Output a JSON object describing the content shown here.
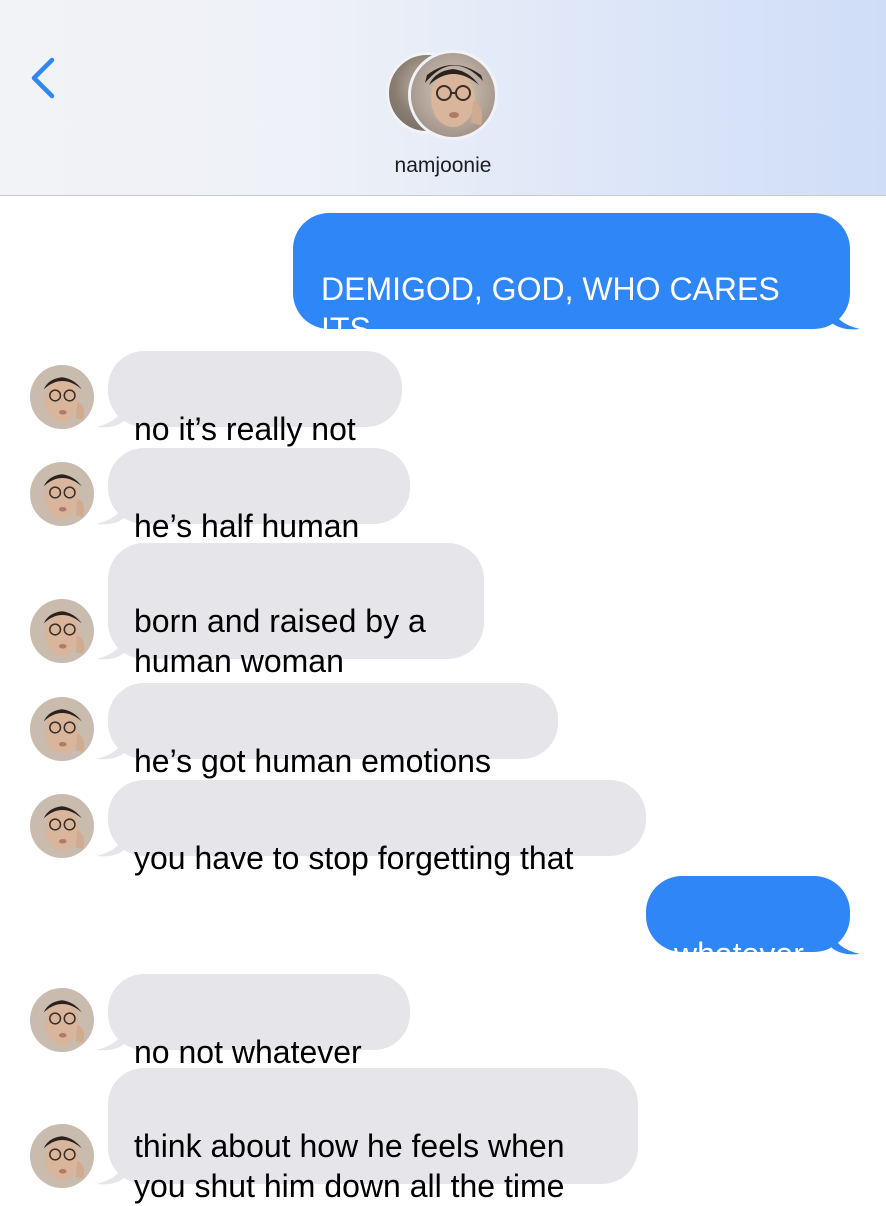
{
  "header": {
    "contact_name": "namjoonie",
    "back_icon": "chevron-left-icon",
    "accent_color": "#2f86f6"
  },
  "messages": [
    {
      "from": "me",
      "text": "DEMIGOD, GOD, WHO CARES ITS\nTHE SAME THING"
    },
    {
      "from": "them",
      "text": "no it’s really not"
    },
    {
      "from": "them",
      "text": "he’s half human"
    },
    {
      "from": "them",
      "text": "born and raised by a\nhuman woman"
    },
    {
      "from": "them",
      "text": "he’s got human emotions"
    },
    {
      "from": "them",
      "text": "you have to stop forgetting that"
    },
    {
      "from": "me",
      "text": "whatever"
    },
    {
      "from": "them",
      "text": "no not whatever"
    },
    {
      "from": "them",
      "text": "think about how he feels when\nyou shut him down all the time"
    }
  ],
  "colors": {
    "incoming_bubble": "#e5e5ea",
    "outgoing_bubble": "#2f86f6"
  }
}
